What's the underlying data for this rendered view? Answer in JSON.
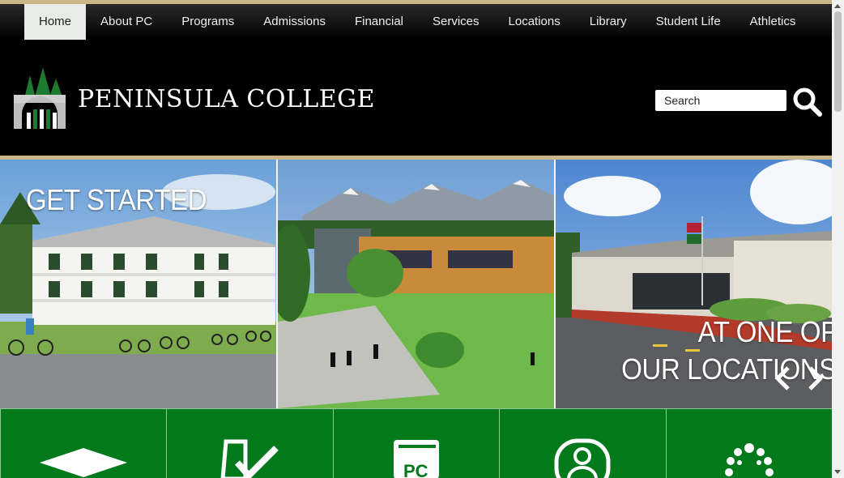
{
  "nav": {
    "items": [
      {
        "label": "Home",
        "active": true
      },
      {
        "label": "About PC"
      },
      {
        "label": "Programs"
      },
      {
        "label": "Admissions"
      },
      {
        "label": "Financial"
      },
      {
        "label": "Services"
      },
      {
        "label": "Locations"
      },
      {
        "label": "Library"
      },
      {
        "label": "Student Life"
      },
      {
        "label": "Athletics"
      }
    ]
  },
  "header": {
    "college_name": "PENINSULA COLLEGE",
    "search_placeholder": "Search",
    "search_icon": "search-icon"
  },
  "hero": {
    "headline_left": "GET STARTED",
    "headline_right_line1": "AT ONE OF",
    "headline_right_line2": "OUR LOCATIONS",
    "prev_icon": "chevron-left-icon",
    "next_icon": "chevron-right-icon"
  },
  "quick_links": [
    {
      "icon": "graduation-cap-icon"
    },
    {
      "icon": "checklist-icon"
    },
    {
      "icon": "book-icon"
    },
    {
      "icon": "user-icon"
    },
    {
      "icon": "dots-circle-icon"
    }
  ],
  "colors": {
    "gold": "#c8b68a",
    "green": "#027a1c",
    "black": "#000000"
  }
}
